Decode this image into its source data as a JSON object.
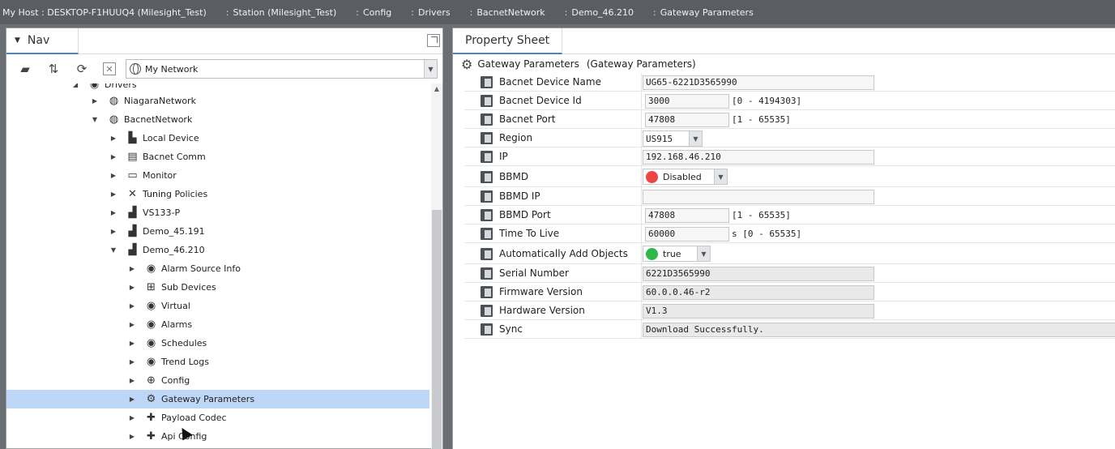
{
  "breadcrumb": [
    "My Host : DESKTOP-F1HUUQ4 (Milesight_Test)",
    "Station (Milesight_Test)",
    "Config",
    "Drivers",
    "BacnetNetwork",
    "Demo_46.210",
    "Gateway Parameters"
  ],
  "nav": {
    "tab_label": "Nav",
    "network_select": "My Network",
    "tree": [
      {
        "label": "Drivers",
        "icon": "drivers-icon",
        "expanded": true
      },
      {
        "label": "NiagaraNetwork",
        "icon": "network-icon",
        "expanded": false
      },
      {
        "label": "BacnetNetwork",
        "icon": "network-icon",
        "expanded": true
      },
      {
        "label": "Local Device",
        "icon": "local-device-icon",
        "expanded": false
      },
      {
        "label": "Bacnet Comm",
        "icon": "comm-icon",
        "expanded": false
      },
      {
        "label": "Monitor",
        "icon": "monitor-icon",
        "expanded": false
      },
      {
        "label": "Tuning Policies",
        "icon": "tuning-icon",
        "expanded": false
      },
      {
        "label": "VS133-P",
        "icon": "device-icon",
        "expanded": false
      },
      {
        "label": "Demo_45.191",
        "icon": "device-icon",
        "expanded": false
      },
      {
        "label": "Demo_46.210",
        "icon": "device-icon",
        "expanded": true
      },
      {
        "label": "Alarm Source Info",
        "icon": "alarm-source-icon",
        "expanded": false
      },
      {
        "label": "Sub Devices",
        "icon": "sub-devices-icon",
        "expanded": false
      },
      {
        "label": "Virtual",
        "icon": "virtual-icon",
        "expanded": false
      },
      {
        "label": "Alarms",
        "icon": "alarms-icon",
        "expanded": false
      },
      {
        "label": "Schedules",
        "icon": "schedules-icon",
        "expanded": false
      },
      {
        "label": "Trend Logs",
        "icon": "trend-logs-icon",
        "expanded": false
      },
      {
        "label": "Config",
        "icon": "config-icon",
        "expanded": false
      },
      {
        "label": "Gateway Parameters",
        "icon": "gear-icon",
        "expanded": false,
        "selected": true
      },
      {
        "label": "Payload Codec",
        "icon": "puzzle-icon",
        "expanded": false
      },
      {
        "label": "Api Config",
        "icon": "puzzle-icon",
        "expanded": false
      }
    ]
  },
  "property_sheet": {
    "tab_label": "Property Sheet",
    "title": "Gateway Parameters",
    "subtitle": "(Gateway Parameters)",
    "rows": [
      {
        "name": "Bacnet Device Name",
        "value": "UG65-6221D3565990"
      },
      {
        "name": "Bacnet Device Id",
        "value": "3000",
        "range": "[0 - 4194303]"
      },
      {
        "name": "Bacnet Port",
        "value": "47808",
        "range": "[1 - 65535]"
      },
      {
        "name": "Region",
        "value": "US915"
      },
      {
        "name": "IP",
        "value": "192.168.46.210"
      },
      {
        "name": "BBMD",
        "value": "Disabled",
        "status_color": "#ee4444"
      },
      {
        "name": "BBMD IP",
        "value": ""
      },
      {
        "name": "BBMD Port",
        "value": "47808",
        "range": "[1 - 65535]"
      },
      {
        "name": "Time To Live",
        "value": "60000",
        "range": "s [0 - 65535]"
      },
      {
        "name": "Automatically Add Objects",
        "value": "true",
        "status_color": "#2fb84a"
      },
      {
        "name": "Serial Number",
        "value": "6221D3565990"
      },
      {
        "name": "Firmware Version",
        "value": "60.0.0.46-r2"
      },
      {
        "name": "Hardware Version",
        "value": "V1.3"
      },
      {
        "name": "Sync",
        "value": "Download Successfully."
      }
    ]
  },
  "colors": {
    "selected_row": "#bfd7f7",
    "tab_accent": "#4a86c5",
    "header_bar": "#5a5d61"
  }
}
